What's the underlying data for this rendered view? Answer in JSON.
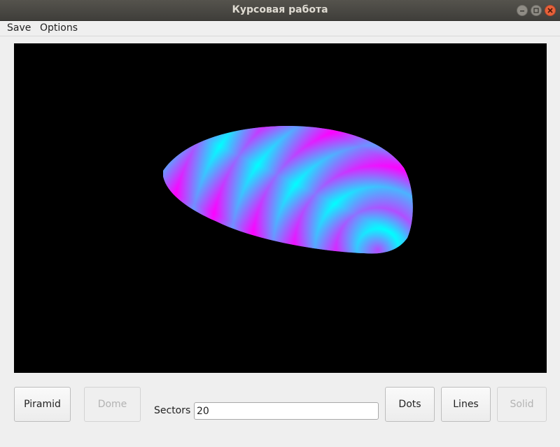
{
  "window": {
    "title": "Курсовая работа"
  },
  "menu": {
    "save": "Save",
    "options": "Options"
  },
  "viewport": {
    "background": "#000000",
    "stripe_colors": [
      "#ff00ff",
      "#00ffff"
    ]
  },
  "controls": {
    "piramid": "Piramid",
    "dome": "Dome",
    "dome_enabled": false,
    "sectors_label": "Sectors",
    "sectors_value": "20",
    "dots": "Dots",
    "lines": "Lines",
    "solid": "Solid",
    "solid_enabled": false
  },
  "colors": {
    "window_bg": "#efefef",
    "titlebar": "#46453f",
    "close_button": "#e8623a"
  }
}
